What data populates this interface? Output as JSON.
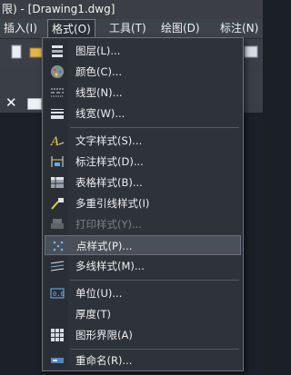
{
  "window": {
    "title": "限) - [Drawing1.dwg]"
  },
  "menubar": {
    "items": [
      {
        "label": "插入(I)"
      },
      {
        "label": "格式(O)"
      },
      {
        "label": "工具(T)"
      },
      {
        "label": "绘图(D)"
      },
      {
        "label": "标注(N)"
      }
    ]
  },
  "format_menu": {
    "items": [
      {
        "label": "图层(L)...",
        "icon": "layers-icon"
      },
      {
        "label": "颜色(C)...",
        "icon": "color-palette-icon"
      },
      {
        "label": "线型(N)...",
        "icon": "linetype-icon"
      },
      {
        "label": "线宽(W)...",
        "icon": "lineweight-icon"
      },
      {
        "label": "文字样式(S)...",
        "icon": "text-style-icon"
      },
      {
        "label": "标注样式(D)...",
        "icon": "dimension-style-icon"
      },
      {
        "label": "表格样式(B)...",
        "icon": "table-style-icon"
      },
      {
        "label": "多重引线样式(I)",
        "icon": "multileader-style-icon"
      },
      {
        "label": "打印样式(Y)...",
        "icon": "plot-style-icon",
        "disabled": true
      },
      {
        "label": "点样式(P)...",
        "icon": "point-style-icon",
        "highlighted": true
      },
      {
        "label": "多线样式(M)...",
        "icon": "multiline-style-icon"
      },
      {
        "label": "单位(U)...",
        "icon": "units-icon"
      },
      {
        "label": "厚度(T)",
        "icon": ""
      },
      {
        "label": "图形界限(A)",
        "icon": "drawing-limits-icon"
      },
      {
        "label": "重命名(R)...",
        "icon": "rename-icon"
      }
    ]
  },
  "tabs": {
    "close_glyph": "✕"
  }
}
